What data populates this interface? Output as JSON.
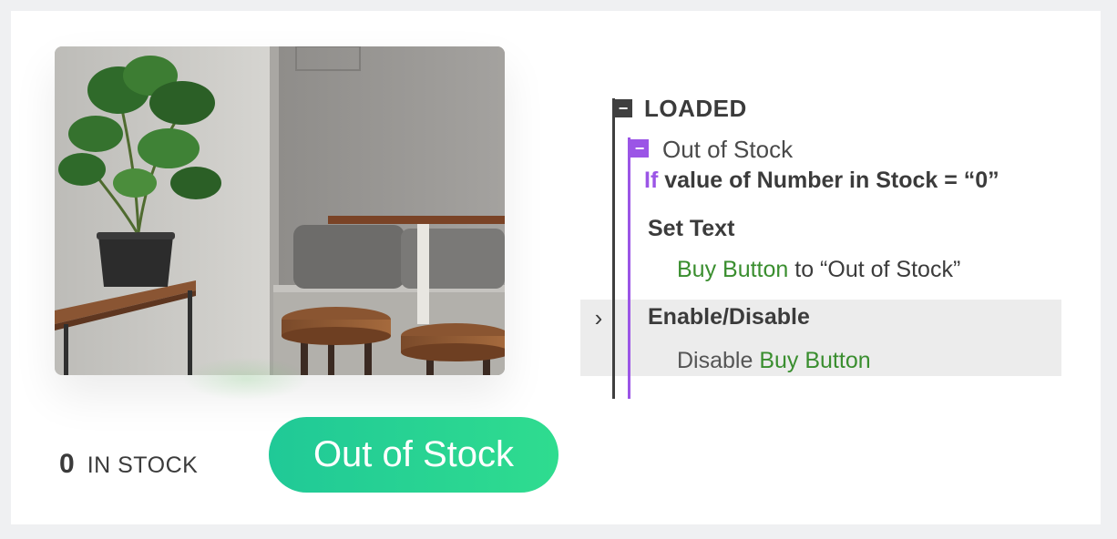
{
  "stock": {
    "count": "0",
    "label": "IN STOCK"
  },
  "buy_button": {
    "label": "Out of Stock"
  },
  "logic": {
    "root": {
      "label": "LOADED",
      "toggle": "−"
    },
    "condition_block": {
      "label": "Out of Stock",
      "toggle": "−",
      "keyword": "If",
      "expression": " value of Number in Stock = “0”"
    },
    "actions": [
      {
        "title": "Set Text",
        "target": "Buy Button",
        "text": " to “Out of Stock”"
      },
      {
        "title": "Enable/Disable",
        "prefix": "Disable ",
        "target": "Buy Button",
        "expand_icon": "›"
      }
    ]
  },
  "colors": {
    "button_gradient_start": "#20c997",
    "button_gradient_end": "#2fdc8f",
    "condition_accent": "#9b55e6",
    "element_reference": "#3a8e2f"
  }
}
